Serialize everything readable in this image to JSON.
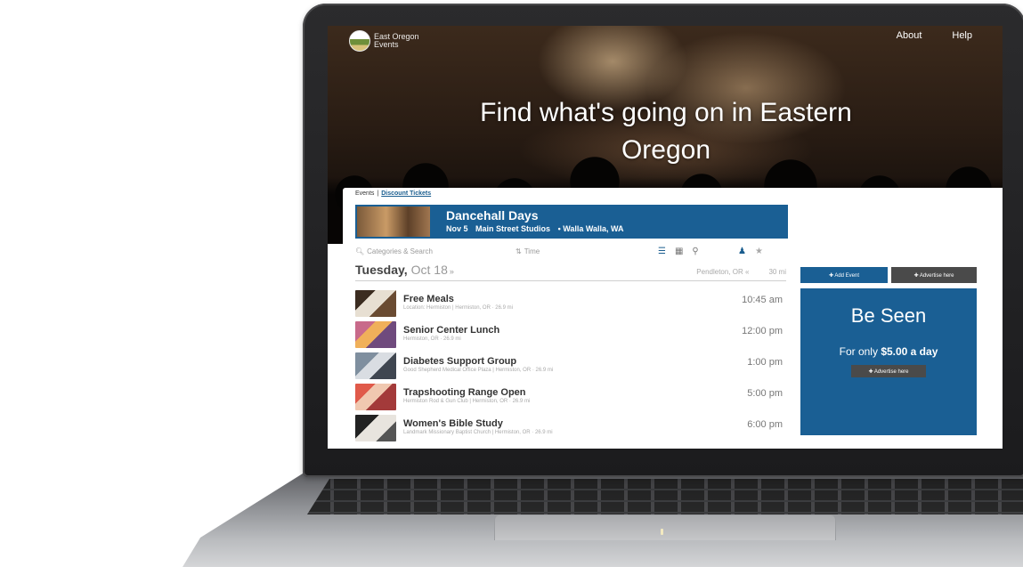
{
  "site": {
    "logo_line1": "East Oregon",
    "logo_line2": "Events",
    "nav": [
      "About",
      "Help"
    ],
    "hero_title": "Find what's going on in Eastern Oregon"
  },
  "tabs": {
    "events_label": "Events",
    "separator": "|",
    "discount_label": "Discount Tickets"
  },
  "featured": {
    "title": "Dancehall Days",
    "date": "Nov 5",
    "venue": "Main Street Studios",
    "city": "• Walla Walla, WA"
  },
  "toolbar": {
    "search_placeholder": "Categories & Search",
    "time_label": "Time"
  },
  "day": {
    "name": "Tuesday,",
    "date": "Oct 18",
    "arrow": "»",
    "location": "Pendleton, OR «",
    "radius": "30 mi"
  },
  "events": [
    {
      "title": "Free Meals",
      "meta": "Location: Hermiston | Hermiston, OR · 26.9 mi",
      "time": "10:45 am"
    },
    {
      "title": "Senior Center Lunch",
      "meta": "Hermiston, OR · 26.9 mi",
      "time": "12:00 pm"
    },
    {
      "title": "Diabetes Support Group",
      "meta": "Good Shepherd Medical Office Plaza | Hermiston, OR · 26.9 mi",
      "time": "1:00 pm"
    },
    {
      "title": "Trapshooting Range Open",
      "meta": "Hermiston Rod & Gun Club | Hermiston, OR · 26.9 mi",
      "time": "5:00 pm"
    },
    {
      "title": "Women's Bible Study",
      "meta": "Landmark Missionary Baptist Church | Hermiston, OR · 26.9 mi",
      "time": "6:00 pm"
    }
  ],
  "sidebar": {
    "add_event": "✚ Add Event",
    "advertise": "✚ Advertise here",
    "ad_title": "Be Seen",
    "ad_sub_prefix": "For only",
    "ad_sub_price": "$5.00 a day",
    "ad_button": "✚ Advertise here"
  },
  "colors": {
    "brand_blue": "#1a5f94",
    "dark_button": "#4a4a4a"
  }
}
